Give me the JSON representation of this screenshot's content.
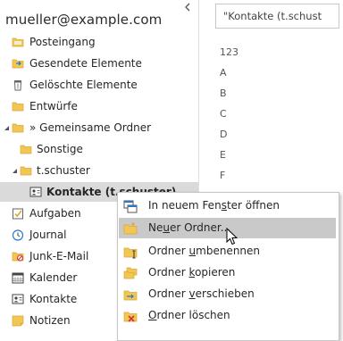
{
  "nav": {
    "account": "mueller@example.com",
    "items": [
      {
        "label": "Posteingang"
      },
      {
        "label": "Gesendete Elemente"
      },
      {
        "label": "Gelöschte Elemente"
      },
      {
        "label": "Entwürfe"
      },
      {
        "label": "» Gemeinsame Ordner"
      },
      {
        "label": "Sonstige"
      },
      {
        "label": "t.schuster"
      },
      {
        "label": "Kontakte (t.schuster)"
      },
      {
        "label": "Aufgaben"
      },
      {
        "label": "Journal"
      },
      {
        "label": "Junk-E-Mail"
      },
      {
        "label": "Kalender"
      },
      {
        "label": "Kontakte"
      },
      {
        "label": "Notizen"
      }
    ]
  },
  "search": {
    "value": "\"Kontakte (t.schust"
  },
  "index": [
    "123",
    "A",
    "B",
    "C",
    "D",
    "E",
    "F"
  ],
  "context_menu": {
    "items": [
      {
        "pre": "In neuem Fen",
        "ul": "s",
        "post": "ter öffnen"
      },
      {
        "pre": "Ne",
        "ul": "u",
        "post": "er Ordner..."
      },
      {
        "pre": "Ordner ",
        "ul": "u",
        "post": "mbenennen"
      },
      {
        "pre": "Ordner ",
        "ul": "k",
        "post": "opieren"
      },
      {
        "pre": "Ordner ",
        "ul": "v",
        "post": "erschieben"
      },
      {
        "pre": "",
        "ul": "O",
        "post": "rdner löschen"
      }
    ]
  },
  "colors": {
    "folder": "#f2c655",
    "folder_dark": "#d9a832",
    "accent": "#2b78c5",
    "selection": "#dadada",
    "menu_hover": "#c9c9c9"
  }
}
